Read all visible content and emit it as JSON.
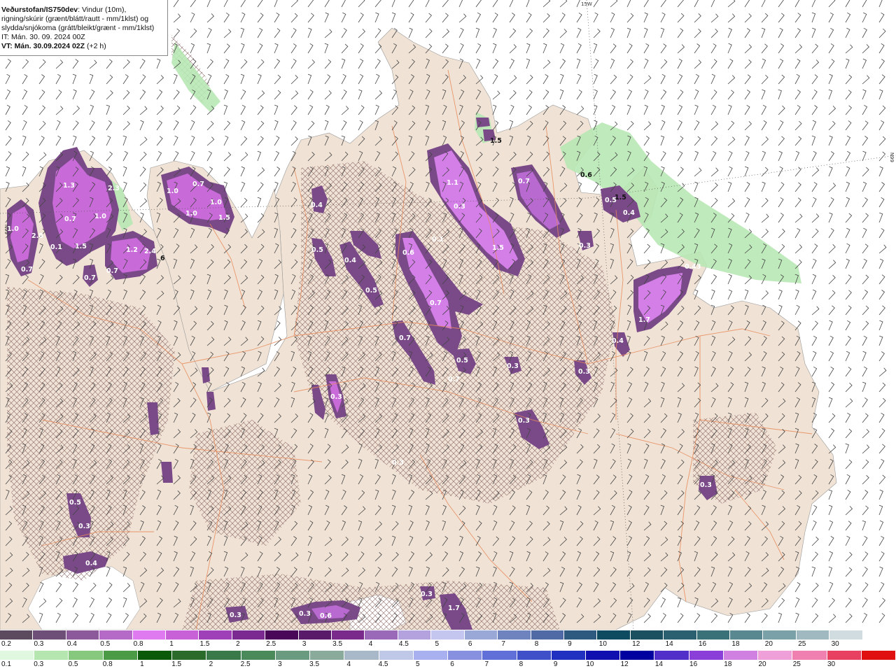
{
  "header": {
    "product": "Veðurstofan/IS750dev",
    "desc1": ": Vindur (10m),",
    "desc2": "rigning/skúrir (grænt/blátt/rautt - mm/1klst) og",
    "desc3": "slydda/snjókoma (grátt/bleikt/grænt - mm/1klst)",
    "it": "IT: Mán. 30. 09. 2024 00Z",
    "vt_label": "VT: Mán. 30.09.2024 02Z",
    "vt_offset": " (+2 h)"
  },
  "grid_labels": {
    "lon_top": "15W",
    "lat_left": "66N",
    "lat_right": "66N"
  },
  "precip_labels": {
    "sleet_snow": [
      "1.3",
      "2.3",
      "1.0",
      "0.7",
      "1.0",
      "1.5",
      "0.7",
      "1.0",
      "2.8",
      "0.1",
      "1.5",
      "0.7",
      "1.2",
      "2.4",
      "0.7",
      "1.0",
      "0.7",
      "1.0",
      "0.7",
      "1.5",
      "0.4",
      "0.5",
      "0.4",
      "0.5",
      "0.6",
      "0.7",
      "1.1",
      "0.3",
      "1.7",
      "0.7",
      "0.1",
      "0.7",
      "0.5",
      "0.3",
      "0.3",
      "0.3",
      "0.3",
      "0.5",
      "0.3",
      "0.4",
      "0.3",
      "0.6",
      "0.3",
      "0.7",
      "0.3",
      "0.4",
      "0.3",
      "1.7",
      "0.43",
      "0.5",
      "0.4",
      "0.3",
      "0.3"
    ],
    "rain": [
      "1.5",
      "0.6",
      "1.5",
      "6"
    ]
  },
  "legend_top": {
    "title": "slydda/snjókoma",
    "colors": [
      "#5c4a5e",
      "#6e4f78",
      "#8c5a9a",
      "#b46ac6",
      "#e07af0",
      "#c860d8",
      "#a040b8",
      "#7a2a90",
      "#4a0858",
      "#5a1a6a",
      "#7a2a8a",
      "#9a6ab8",
      "#b4a2de",
      "#c4c6f0",
      "#9aa8d8",
      "#6f84bf",
      "#4f6aa4",
      "#2f5a80",
      "#0e4a60",
      "#1a5060",
      "#2a6070",
      "#3a7078",
      "#5a8890",
      "#7aa0a8",
      "#a0b8c0",
      "#d0dcdf",
      "#ffffff"
    ],
    "ticks": [
      "0.2",
      "0.3",
      "0.4",
      "0.5",
      "0.8",
      "1",
      "1.5",
      "2",
      "2.5",
      "3",
      "3.5",
      "4",
      "4.5",
      "5",
      "6",
      "7",
      "8",
      "9",
      "10",
      "12",
      "14",
      "16",
      "18",
      "20",
      "25",
      "30"
    ]
  },
  "legend_bottom": {
    "title": "rigning/skúrir",
    "colors": [
      "#dff8df",
      "#b6e6b0",
      "#86c97e",
      "#4a9a46",
      "#0a5a0a",
      "#2a6a2a",
      "#3a7a4a",
      "#4a8a5a",
      "#6a9a80",
      "#8aaa9c",
      "#a8b8c8",
      "#c0c8e8",
      "#a8b0f0",
      "#8890e0",
      "#6070d8",
      "#4050c8",
      "#2030c0",
      "#1010b0",
      "#0000a0",
      "#5030c8",
      "#8a40d8",
      "#d080e0",
      "#f0a0d8",
      "#f080b0",
      "#e84060",
      "#e01010"
    ],
    "ticks": [
      "0.1",
      "0.3",
      "0.5",
      "0.8",
      "1",
      "1.5",
      "2",
      "2.5",
      "3",
      "3.5",
      "4",
      "4.5",
      "5",
      "6",
      "7",
      "8",
      "9",
      "10",
      "12",
      "14",
      "16",
      "18",
      "20",
      "25",
      "30"
    ]
  }
}
